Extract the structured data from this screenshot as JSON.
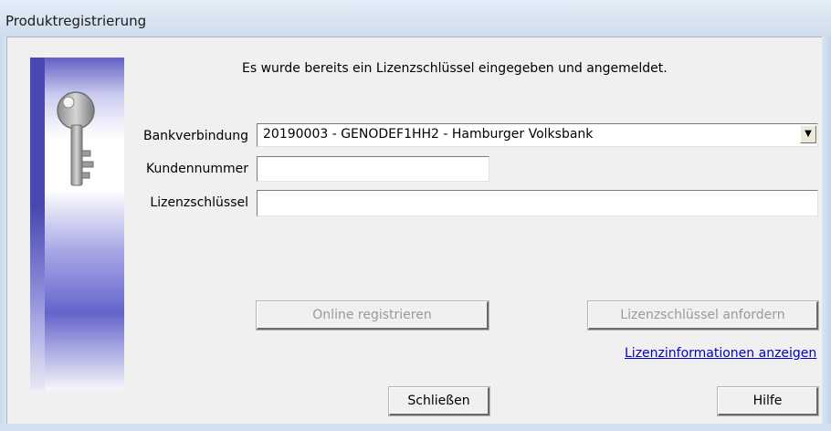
{
  "window": {
    "title": "Produktregistrierung"
  },
  "sidebar": {
    "icon": "key-icon"
  },
  "info_text": "Es wurde bereits ein Lizenzschlüssel eingegeben und angemeldet.",
  "form": {
    "bank_label": "Bankverbindung",
    "bank_value": "20190003 - GENODEF1HH2 - Hamburger Volksbank",
    "customer_label": "Kundennummer",
    "customer_value": "",
    "license_label": "Lizenzschlüssel",
    "license_value": ""
  },
  "buttons": {
    "online_register": "Online registrieren",
    "request_license": "Lizenzschlüssel anfordern",
    "license_info_link": "Lizenzinformationen anzeigen",
    "close": "Schließen",
    "help": "Hilfe"
  },
  "colors": {
    "sidebar_dark": "#4848b4",
    "link": "#0000c8",
    "disabled_text": "#9a9a9a"
  }
}
